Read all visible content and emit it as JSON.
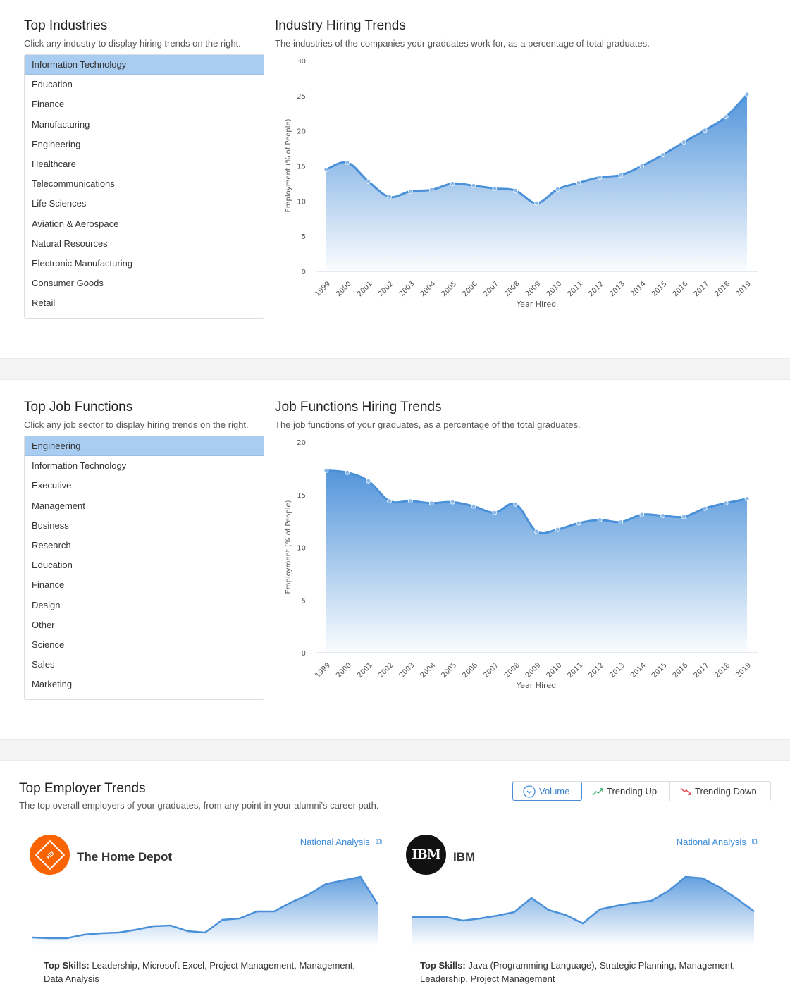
{
  "industries": {
    "title": "Top Industries",
    "subtitle": "Click any industry to display hiring trends on the right.",
    "items": [
      "Information Technology",
      "Education",
      "Finance",
      "Manufacturing",
      "Engineering",
      "Healthcare",
      "Telecommunications",
      "Life Sciences",
      "Aviation & Aerospace",
      "Natural Resources",
      "Electronic Manufacturing",
      "Consumer Goods",
      "Retail"
    ],
    "selected": "Information Technology"
  },
  "jobs": {
    "title": "Top Job Functions",
    "subtitle": "Click any job sector to display hiring trends on the right.",
    "items": [
      "Engineering",
      "Information Technology",
      "Executive",
      "Management",
      "Business",
      "Research",
      "Education",
      "Finance",
      "Design",
      "Other",
      "Science",
      "Sales",
      "Marketing"
    ],
    "selected": "Engineering"
  },
  "chart_data": [
    {
      "type": "area",
      "title": "Industry Hiring Trends",
      "subtitle": "The industries of the companies your graduates work for, as a percentage of total graduates.",
      "xlabel": "Year Hired",
      "ylabel": "Employment (% of People)",
      "ylim": [
        0,
        30
      ],
      "yticks": [
        0,
        5,
        10,
        15,
        20,
        25,
        30
      ],
      "grid": false,
      "color": "#4a90d9",
      "x": [
        "1999",
        "2000",
        "2001",
        "2002",
        "2003",
        "2004",
        "2005",
        "2006",
        "2007",
        "2008",
        "2009",
        "2010",
        "2011",
        "2012",
        "2013",
        "2014",
        "2015",
        "2016",
        "2017",
        "2018",
        "2019"
      ],
      "values": [
        14.5,
        15.5,
        12.8,
        10.6,
        11.4,
        11.6,
        12.5,
        12.2,
        11.8,
        11.5,
        9.7,
        11.7,
        12.6,
        13.4,
        13.7,
        15.0,
        16.6,
        18.4,
        20.1,
        22.0,
        25.2
      ]
    },
    {
      "type": "area",
      "title": "Job Functions Hiring Trends",
      "subtitle": "The job functions of your graduates, as a percentage of the total graduates.",
      "xlabel": "Year Hired",
      "ylabel": "Employment (% of People)",
      "ylim": [
        0,
        20
      ],
      "yticks": [
        0,
        5,
        10,
        15,
        20
      ],
      "grid": false,
      "color": "#4a90d9",
      "x": [
        "1999",
        "2000",
        "2001",
        "2002",
        "2003",
        "2004",
        "2005",
        "2006",
        "2007",
        "2008",
        "2009",
        "2010",
        "2011",
        "2012",
        "2013",
        "2014",
        "2015",
        "2016",
        "2017",
        "2018",
        "2019"
      ],
      "values": [
        17.3,
        17.1,
        16.3,
        14.4,
        14.4,
        14.2,
        14.3,
        13.9,
        13.3,
        14.1,
        11.5,
        11.7,
        12.3,
        12.6,
        12.4,
        13.1,
        13.0,
        12.9,
        13.7,
        14.2,
        14.6
      ]
    }
  ],
  "employers": {
    "title": "Top Employer Trends",
    "subtitle": "The top overall employers of your graduates, from any point in your alumni's career path.",
    "tabs": [
      {
        "label": "Volume",
        "icon": "chevron-circle-icon",
        "active": true
      },
      {
        "label": "Trending Up",
        "icon": "trend-up-icon",
        "color": "#3aaa6a"
      },
      {
        "label": "Trending Down",
        "icon": "trend-down-icon",
        "color": "#e0474c"
      }
    ],
    "cards": [
      {
        "name": "The Home Depot",
        "logo_text": "THE HOME DEPOT",
        "logo_color": "#f96302",
        "link": "National Analysis",
        "skills_label": "Top Skills:",
        "skills": "Leadership, Microsoft Excel, Project Management, Management, Data Analysis",
        "trend": [
          8,
          7,
          7,
          12,
          14,
          15,
          19,
          24,
          25,
          17,
          15,
          33,
          35,
          45,
          45,
          58,
          69,
          84,
          89,
          94,
          55
        ]
      },
      {
        "name": "IBM",
        "logo_text": "IBM",
        "logo_color": "#111111",
        "link": "National Analysis",
        "skills_label": "Top Skills:",
        "skills": "Java (Programming Language), Strategic Planning, Management, Leadership, Project Management",
        "trend": [
          37,
          37,
          37,
          32,
          35,
          39,
          44,
          64,
          47,
          40,
          28,
          48,
          53,
          57,
          60,
          74,
          94,
          92,
          79,
          63,
          45
        ]
      }
    ]
  }
}
